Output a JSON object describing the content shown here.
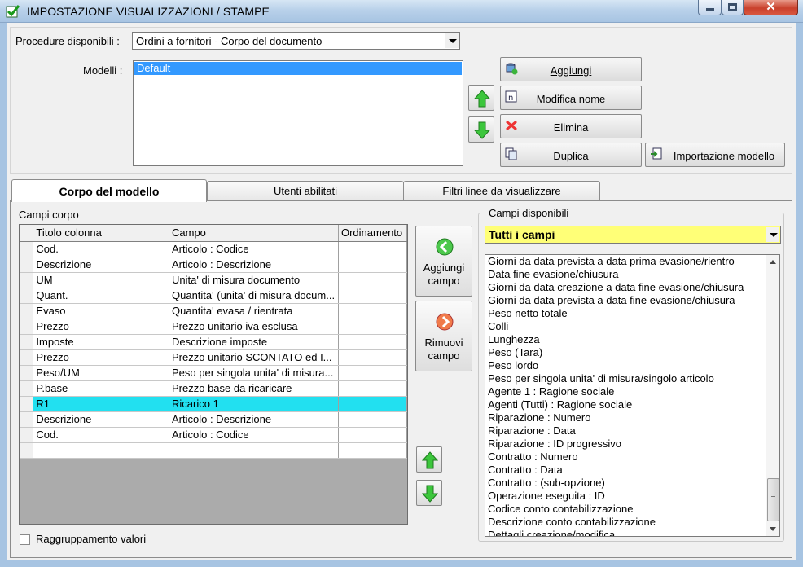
{
  "window": {
    "title": "IMPOSTAZIONE VISUALIZZAZIONI / STAMPE"
  },
  "top": {
    "procedure_label": "Procedure disponibili :",
    "procedure_value": "Ordini a fornitori - Corpo del documento",
    "models_label": "Modelli :",
    "models": [
      "Default"
    ],
    "buttons": {
      "add": "Aggiungi",
      "rename": "Modifica nome",
      "delete": "Elimina",
      "duplicate": "Duplica",
      "import": "Importazione modello"
    }
  },
  "tabs": [
    {
      "label": "Corpo del modello",
      "active": true
    },
    {
      "label": "Utenti abilitati",
      "active": false
    },
    {
      "label": "Filtri linee da visualizzare",
      "active": false
    }
  ],
  "body": {
    "grid_label": "Campi corpo",
    "columns": [
      "Titolo colonna",
      "Campo",
      "Ordinamento"
    ],
    "rows": [
      [
        "Cod.",
        "Articolo : Codice",
        ""
      ],
      [
        "Descrizione",
        "Articolo : Descrizione",
        ""
      ],
      [
        "UM",
        "Unita' di misura documento",
        ""
      ],
      [
        "Quant.",
        "Quantita' (unita' di misura docum...",
        ""
      ],
      [
        "Evaso",
        "Quantita' evasa / rientrata",
        ""
      ],
      [
        "Prezzo",
        "Prezzo unitario iva esclusa",
        ""
      ],
      [
        "Imposte",
        "Descrizione imposte",
        ""
      ],
      [
        "Prezzo",
        "Prezzo unitario SCONTATO ed I...",
        ""
      ],
      [
        "Peso/UM",
        "Peso per singola unita' di misura...",
        ""
      ],
      [
        "P.base",
        "Prezzo base da ricaricare",
        ""
      ],
      [
        "R1",
        "Ricarico 1",
        ""
      ],
      [
        "Descrizione",
        "Articolo : Descrizione",
        ""
      ],
      [
        "Cod.",
        "Articolo : Codice",
        ""
      ],
      [
        "",
        "",
        ""
      ]
    ],
    "highlighted_row": 10,
    "add_field_button": [
      "Aggiungi",
      "campo"
    ],
    "remove_field_button": [
      "Rimuovi",
      "campo"
    ],
    "group_values_label": "Raggruppamento valori"
  },
  "available": {
    "legend": "Campi disponibili",
    "filter_value": "Tutti i campi",
    "fields": [
      "Giorni da data prevista a data prima evasione/rientro",
      "Data fine evasione/chiusura",
      "Giorni da data creazione a data fine evasione/chiusura",
      "Giorni da data prevista a data fine evasione/chiusura",
      "Peso netto totale",
      "Colli",
      "Lunghezza",
      "Peso (Tara)",
      "Peso lordo",
      "Peso per singola unita' di misura/singolo articolo",
      "Agente 1 : Ragione sociale",
      "Agenti (Tutti) : Ragione sociale",
      "Riparazione : Numero",
      "Riparazione : Data",
      "Riparazione : ID progressivo",
      "Contratto : Numero",
      "Contratto : Data",
      "Contratto : (sub-opzione)",
      "Operazione eseguita : ID",
      "Codice conto contabilizzazione",
      "Descrizione conto contabilizzazione",
      "Dettagli creazione/modifica"
    ]
  },
  "colors": {
    "highlight_row": "#22e0f0",
    "selection": "#3399ff",
    "filter_combo": "#ffff77",
    "close_button": "#c9402c"
  }
}
